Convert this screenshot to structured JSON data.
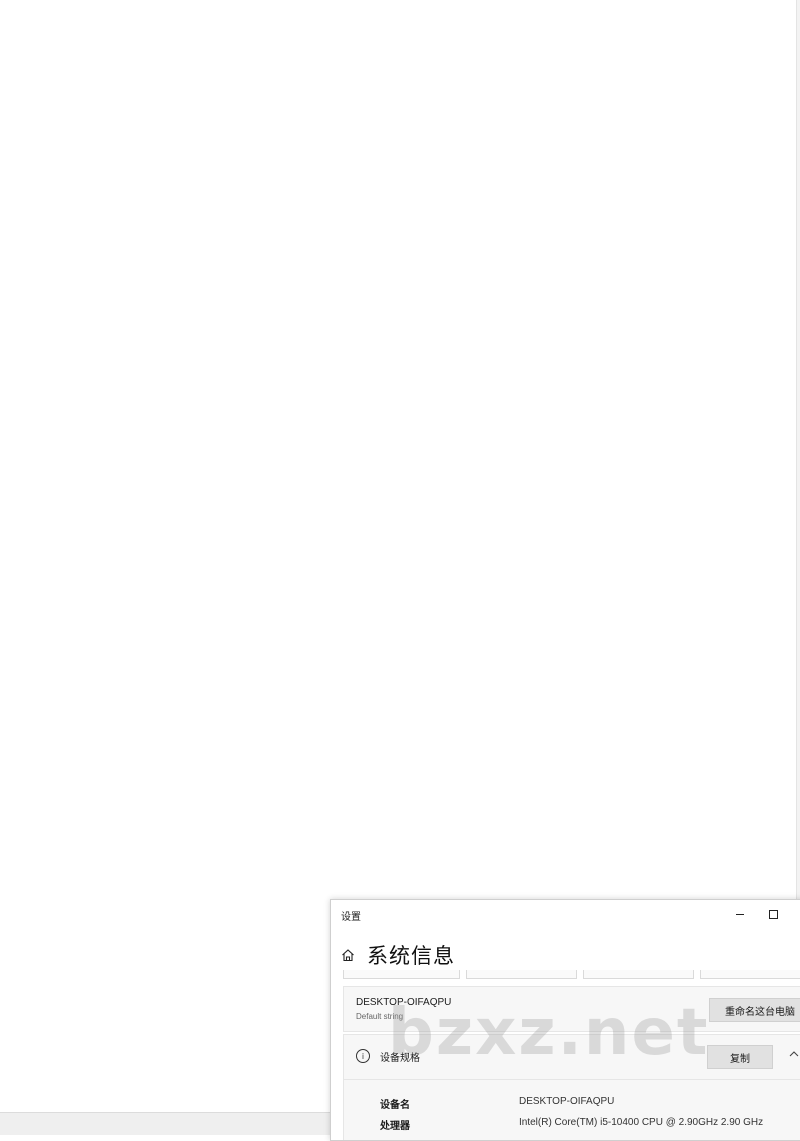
{
  "window": {
    "title": "设置",
    "minimize_label": "–",
    "maximize_label": "□"
  },
  "header": {
    "title": "系统信息",
    "home_icon": "home-icon"
  },
  "device": {
    "name": "DESKTOP-OIFAQPU",
    "subtitle": "Default string",
    "rename_button": "重命名这台电脑"
  },
  "specs": {
    "label": "设备规格",
    "copy_button": "复制",
    "info_icon": "info-icon",
    "chevron_icon": "chevron-up-icon",
    "rows": [
      {
        "key": "设备名",
        "value": "DESKTOP-OIFAQPU"
      },
      {
        "key": "处理器",
        "value": "Intel(R) Core(TM) i5-10400 CPU @ 2.90GHz   2.90 GHz"
      }
    ]
  },
  "watermark": "bzxz.net"
}
